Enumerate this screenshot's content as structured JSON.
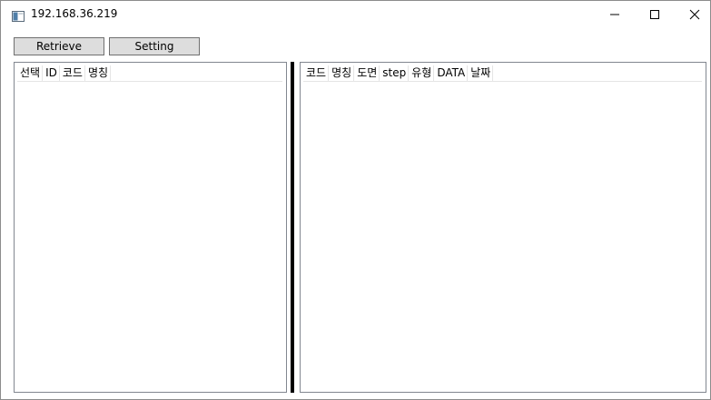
{
  "window": {
    "title": "192.168.36.219",
    "icon": "app-window-icon",
    "controls": [
      "minimize-icon",
      "maximize-icon",
      "close-icon"
    ]
  },
  "toolbar": {
    "retrieve_label": "Retrieve",
    "setting_label": "Setting"
  },
  "left_list": {
    "columns": [
      "선택",
      "ID",
      "코드",
      "명칭"
    ],
    "rows": []
  },
  "right_list": {
    "columns": [
      "코드",
      "명칭",
      "도면",
      "step",
      "유형",
      "DATA",
      "날짜"
    ],
    "rows": []
  },
  "colors": {
    "button_face": "#dddddd",
    "button_border": "#707070",
    "list_border": "#828790",
    "splitter": "#000000"
  }
}
